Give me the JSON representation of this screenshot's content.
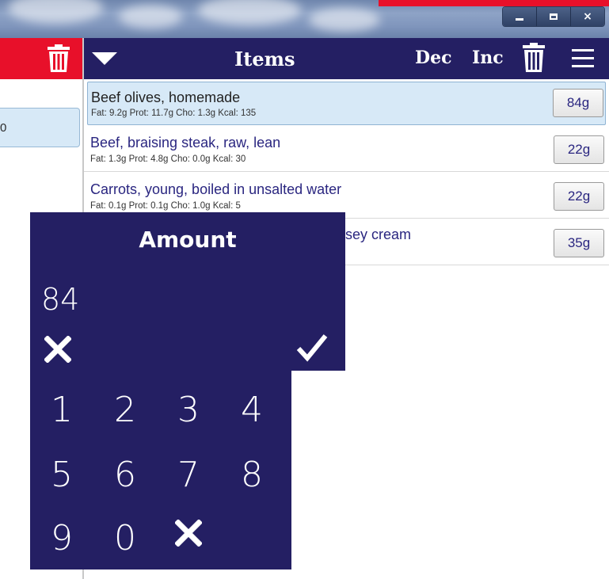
{
  "window": {
    "controls": {
      "close_label": "×"
    }
  },
  "left_pane": {
    "selected_item_fragment": "0"
  },
  "header": {
    "title": "Items",
    "dec_label": "Dec",
    "inc_label": "Inc"
  },
  "items": [
    {
      "name": "Beef olives, homemade",
      "macros": "Fat: 9.2g Prot: 11.7g Cho: 1.3g Kcal: 135",
      "amount": "84g",
      "selected": true
    },
    {
      "name": "Beef, braising steak, raw, lean",
      "macros": "Fat: 1.3g Prot: 4.8g Cho: 0.0g Kcal: 30",
      "amount": "22g",
      "selected": false
    },
    {
      "name": "Carrots, young, boiled in unsalted water",
      "macros": "Fat: 0.1g Prot: 0.1g Cho: 1.0g Kcal: 5",
      "amount": "22g",
      "selected": false
    },
    {
      "name": "sey cream",
      "macros": "",
      "amount": "35g",
      "selected": false
    }
  ],
  "amount_dialog": {
    "title": "Amount",
    "value": "84",
    "cancel_icon": "×",
    "confirm_icon": "✓"
  },
  "keypad": {
    "keys": [
      "1",
      "2",
      "3",
      "4",
      "5",
      "6",
      "7",
      "8",
      "9",
      "0"
    ],
    "backspace_icon": "×"
  },
  "colors": {
    "accent_red": "#e8102a",
    "navy": "#241f63",
    "selected_row": "#d7e9f7"
  }
}
